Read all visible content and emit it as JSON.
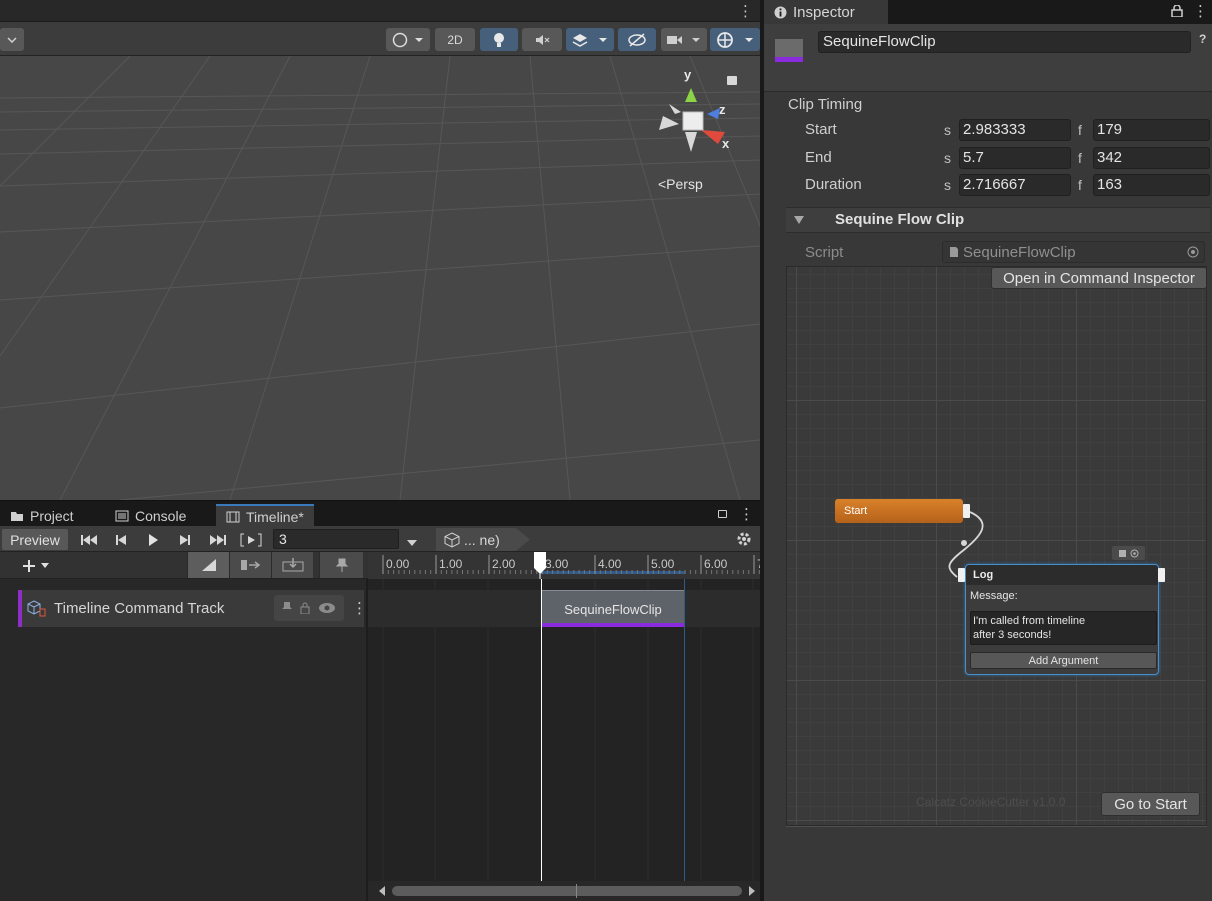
{
  "scene": {
    "toolbar": {
      "mode_2d": "2D"
    },
    "persp_label": "<Persp",
    "gizmo_axes": {
      "y": "y",
      "z": "z",
      "x": "x"
    }
  },
  "bottom_tabs": [
    {
      "label": "Project",
      "icon": "folder-icon"
    },
    {
      "label": "Console",
      "icon": "console-icon"
    },
    {
      "label": "Timeline*",
      "icon": "timeline-icon"
    }
  ],
  "timeline": {
    "preview_label": "Preview",
    "frame_value": "3",
    "breadcrumb": "... ne)",
    "ruler_labels": [
      "0.00",
      "1.00",
      "2.00",
      "3.00",
      "4.00",
      "5.00",
      "6.00",
      "7"
    ],
    "playhead_time": 3.0,
    "track": {
      "name": "Timeline Command Track",
      "color": "#8e2ec7"
    },
    "clip": {
      "label": "SequineFlowClip",
      "start": 2.983333,
      "end": 5.7,
      "color": "#8b2be0"
    }
  },
  "inspector": {
    "tab_label": "Inspector",
    "object_name": "SequineFlowClip",
    "clip_timing": {
      "title": "Clip Timing",
      "rows": [
        {
          "label": "Start",
          "s_label": "s",
          "seconds": "2.983333",
          "f_label": "f",
          "frames": "179"
        },
        {
          "label": "End",
          "s_label": "s",
          "seconds": "5.7",
          "f_label": "f",
          "frames": "342"
        },
        {
          "label": "Duration",
          "s_label": "s",
          "seconds": "2.716667",
          "f_label": "f",
          "frames": "163"
        }
      ]
    },
    "component": {
      "title": "Sequine Flow Clip",
      "script_label": "Script",
      "script_value": "SequineFlowClip"
    },
    "graph": {
      "open_button": "Open in Command Inspector",
      "start_node": "Start",
      "log_node": {
        "title": "Log",
        "message_label": "Message:",
        "message_value": "I'm called from timeline\nafter 3 seconds!",
        "add_argument": "Add Argument"
      },
      "watermark": "Calcatz CookieCutter v1.0.0",
      "goto_start": "Go to Start"
    }
  }
}
